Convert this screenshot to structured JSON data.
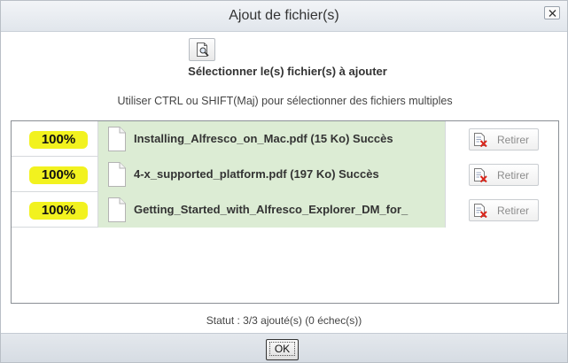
{
  "dialog": {
    "title": "Ajout de fichier(s)",
    "close_icon": "close-icon",
    "select_icon": "file-browse-icon",
    "select_label": "Sélectionner le(s) fichier(s) à ajouter",
    "hint": "Utiliser CTRL ou SHIFT(Maj) pour sélectionner des fichiers multiples",
    "status": "Statut : 3/3 ajouté(s) (0 échec(s))",
    "ok_label": "OK"
  },
  "files": [
    {
      "progress": "100%",
      "text": "Installing_Alfresco_on_Mac.pdf (15 Ko) Succès",
      "remove_label": "Retirer"
    },
    {
      "progress": "100%",
      "text": "4-x_supported_platform.pdf (197 Ko) Succès",
      "remove_label": "Retirer"
    },
    {
      "progress": "100%",
      "text": "Getting_Started_with_Alfresco_Explorer_DM_for_",
      "remove_label": "Retirer"
    }
  ],
  "colors": {
    "progress_highlight": "#f2f21f",
    "file_cell_bg": "#dcecd4",
    "remove_icon_red": "#d9261c"
  }
}
